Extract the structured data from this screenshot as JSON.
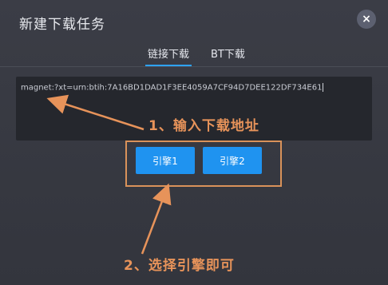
{
  "dialog": {
    "title": "新建下载任务",
    "close_symbol": "×"
  },
  "tabs": [
    {
      "label": "链接下载",
      "active": true
    },
    {
      "label": "BT下载",
      "active": false
    }
  ],
  "link_input": {
    "value": "magnet:?xt=urn:btih:7A16BD1DAD1F3EE4059A7CF94D7DEE122DF734E61"
  },
  "engines": [
    {
      "label": "引擎1"
    },
    {
      "label": "引擎2"
    }
  ],
  "annotations": {
    "step1": "1、输入下载地址",
    "step2": "2、选择引擎即可"
  },
  "colors": {
    "accent": "#1f93f0",
    "annotation": "#e7935a",
    "tab_underline": "#2ea3ff"
  }
}
